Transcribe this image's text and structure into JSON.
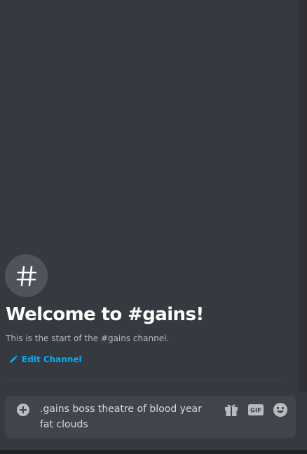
{
  "channel": {
    "name": "gains",
    "welcome_title": "Welcome to #gains!",
    "welcome_subtitle": "This is the start of the #gains channel.",
    "edit_label": "Edit Channel",
    "icon": "hash-icon"
  },
  "composer": {
    "message_line_1": ".gains boss theatre of blood year",
    "message_line_2": "fat clouds",
    "gif_label": "GIF",
    "icons": [
      "plus-circle-icon",
      "gift-icon",
      "gif-icon",
      "emoji-icon"
    ]
  },
  "colors": {
    "background": "#36393f",
    "composer": "#40444b",
    "link": "#00aff4",
    "icon_circle": "#4f545c"
  }
}
